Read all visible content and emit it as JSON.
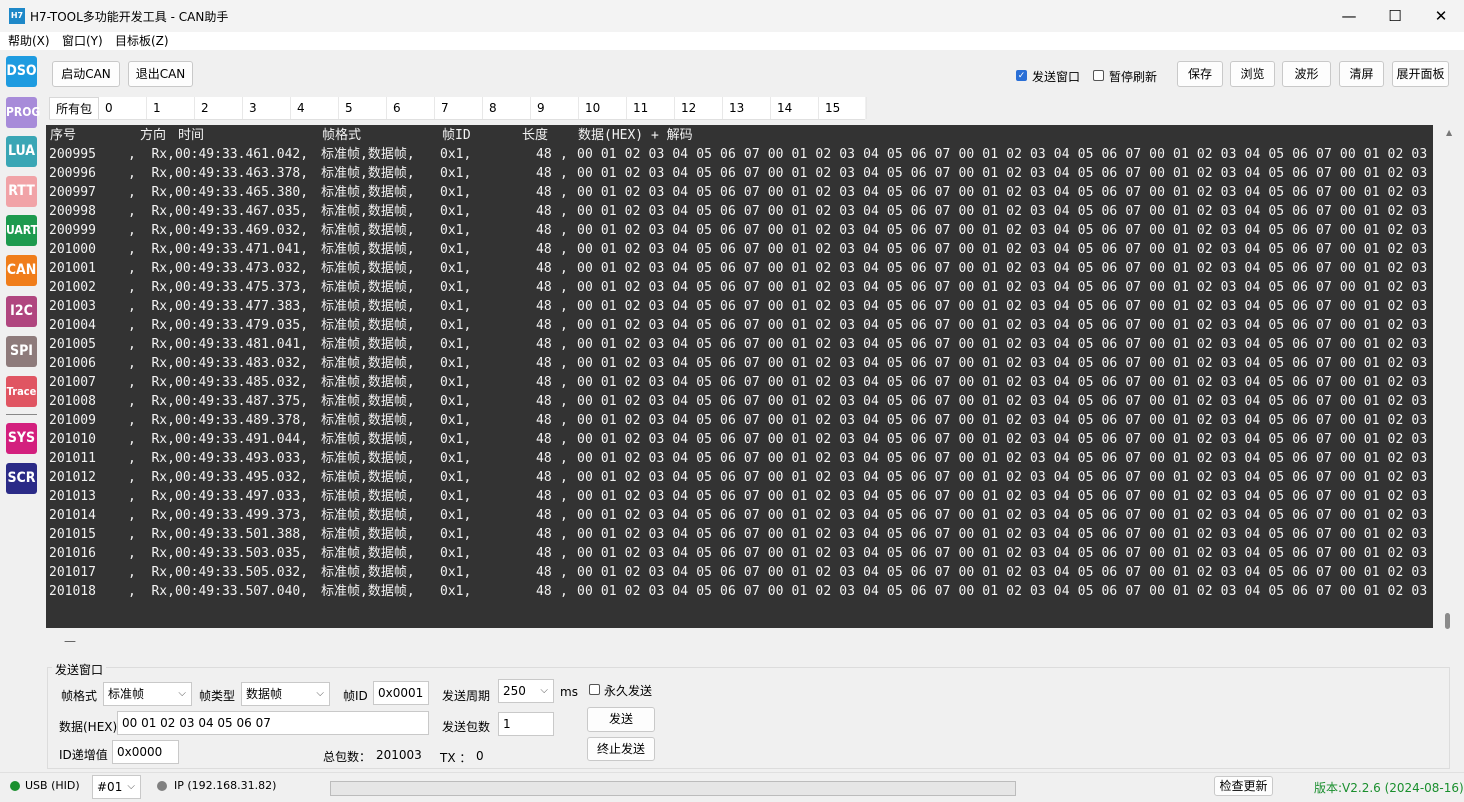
{
  "window": {
    "title": "H7-TOOL多功能开发工具 - CAN助手",
    "icon_text": "H7",
    "minimize": "—",
    "maximize": "☐",
    "close": "✕"
  },
  "menu": [
    "帮助(X)",
    "窗口(Y)",
    "目标板(Z)"
  ],
  "sidebar": [
    {
      "label": "DSO",
      "color": "#1e9be0"
    },
    {
      "label": "PROG",
      "color": "#a78bd9"
    },
    {
      "label": "LUA",
      "color": "#3aa6b5"
    },
    {
      "label": "RTT",
      "color": "#f1a3a7"
    },
    {
      "label": "UART",
      "color": "#1d9a4e"
    },
    {
      "label": "CAN",
      "color": "#f07d1a"
    },
    {
      "label": "I2C",
      "color": "#b0467f"
    },
    {
      "label": "SPI",
      "color": "#8e7b7b"
    },
    {
      "label": "Trace",
      "color": "#e05562"
    },
    {
      "label": "SYS",
      "color": "#d3207e"
    },
    {
      "label": "SCR",
      "color": "#2b2b87"
    }
  ],
  "toolbar": {
    "start_can": "启动CAN",
    "exit_can": "退出CAN",
    "send_window_label": "发送窗口",
    "send_window_checked": true,
    "pause_refresh_label": "暂停刷新",
    "pause_refresh_checked": false,
    "save": "保存",
    "browse": "浏览",
    "wave": "波形",
    "clear": "清屏",
    "expand_panel": "展开面板"
  },
  "tabs": [
    "所有包",
    "0",
    "1",
    "2",
    "3",
    "4",
    "5",
    "6",
    "7",
    "8",
    "9",
    "10",
    "11",
    "12",
    "13",
    "14",
    "15"
  ],
  "console": {
    "header": {
      "seq": "序号",
      "dir": "方向",
      "time": "时间",
      "format": "帧格式",
      "id": "帧ID",
      "len": "长度",
      "data": "数据(HEX) + 解码"
    },
    "rows": [
      {
        "seq": "200995",
        "dir": "Rx,",
        "time": "00:49:33.461.042,",
        "fmt": "标准帧,数据帧,",
        "id": "0x1,",
        "len": "48",
        "sep": ",",
        "hex": "00 01 02 03 04 05 06 07 00 01 02 03 04 05 06 07 00 01 02 03 04 05 06 07 00 01 02 03 04 05 06 07 00 01 02 03"
      },
      {
        "seq": "200996",
        "dir": "Rx,",
        "time": "00:49:33.463.378,",
        "fmt": "标准帧,数据帧,",
        "id": "0x1,",
        "len": "48",
        "sep": ",",
        "hex": "00 01 02 03 04 05 06 07 00 01 02 03 04 05 06 07 00 01 02 03 04 05 06 07 00 01 02 03 04 05 06 07 00 01 02 03"
      },
      {
        "seq": "200997",
        "dir": "Rx,",
        "time": "00:49:33.465.380,",
        "fmt": "标准帧,数据帧,",
        "id": "0x1,",
        "len": "48",
        "sep": ",",
        "hex": "00 01 02 03 04 05 06 07 00 01 02 03 04 05 06 07 00 01 02 03 04 05 06 07 00 01 02 03 04 05 06 07 00 01 02 03"
      },
      {
        "seq": "200998",
        "dir": "Rx,",
        "time": "00:49:33.467.035,",
        "fmt": "标准帧,数据帧,",
        "id": "0x1,",
        "len": "48",
        "sep": ",",
        "hex": "00 01 02 03 04 05 06 07 00 01 02 03 04 05 06 07 00 01 02 03 04 05 06 07 00 01 02 03 04 05 06 07 00 01 02 03"
      },
      {
        "seq": "200999",
        "dir": "Rx,",
        "time": "00:49:33.469.032,",
        "fmt": "标准帧,数据帧,",
        "id": "0x1,",
        "len": "48",
        "sep": ",",
        "hex": "00 01 02 03 04 05 06 07 00 01 02 03 04 05 06 07 00 01 02 03 04 05 06 07 00 01 02 03 04 05 06 07 00 01 02 03"
      },
      {
        "seq": "201000",
        "dir": "Rx,",
        "time": "00:49:33.471.041,",
        "fmt": "标准帧,数据帧,",
        "id": "0x1,",
        "len": "48",
        "sep": ",",
        "hex": "00 01 02 03 04 05 06 07 00 01 02 03 04 05 06 07 00 01 02 03 04 05 06 07 00 01 02 03 04 05 06 07 00 01 02 03"
      },
      {
        "seq": "201001",
        "dir": "Rx,",
        "time": "00:49:33.473.032,",
        "fmt": "标准帧,数据帧,",
        "id": "0x1,",
        "len": "48",
        "sep": ",",
        "hex": "00 01 02 03 04 05 06 07 00 01 02 03 04 05 06 07 00 01 02 03 04 05 06 07 00 01 02 03 04 05 06 07 00 01 02 03"
      },
      {
        "seq": "201002",
        "dir": "Rx,",
        "time": "00:49:33.475.373,",
        "fmt": "标准帧,数据帧,",
        "id": "0x1,",
        "len": "48",
        "sep": ",",
        "hex": "00 01 02 03 04 05 06 07 00 01 02 03 04 05 06 07 00 01 02 03 04 05 06 07 00 01 02 03 04 05 06 07 00 01 02 03"
      },
      {
        "seq": "201003",
        "dir": "Rx,",
        "time": "00:49:33.477.383,",
        "fmt": "标准帧,数据帧,",
        "id": "0x1,",
        "len": "48",
        "sep": ",",
        "hex": "00 01 02 03 04 05 06 07 00 01 02 03 04 05 06 07 00 01 02 03 04 05 06 07 00 01 02 03 04 05 06 07 00 01 02 03"
      },
      {
        "seq": "201004",
        "dir": "Rx,",
        "time": "00:49:33.479.035,",
        "fmt": "标准帧,数据帧,",
        "id": "0x1,",
        "len": "48",
        "sep": ",",
        "hex": "00 01 02 03 04 05 06 07 00 01 02 03 04 05 06 07 00 01 02 03 04 05 06 07 00 01 02 03 04 05 06 07 00 01 02 03"
      },
      {
        "seq": "201005",
        "dir": "Rx,",
        "time": "00:49:33.481.041,",
        "fmt": "标准帧,数据帧,",
        "id": "0x1,",
        "len": "48",
        "sep": ",",
        "hex": "00 01 02 03 04 05 06 07 00 01 02 03 04 05 06 07 00 01 02 03 04 05 06 07 00 01 02 03 04 05 06 07 00 01 02 03"
      },
      {
        "seq": "201006",
        "dir": "Rx,",
        "time": "00:49:33.483.032,",
        "fmt": "标准帧,数据帧,",
        "id": "0x1,",
        "len": "48",
        "sep": ",",
        "hex": "00 01 02 03 04 05 06 07 00 01 02 03 04 05 06 07 00 01 02 03 04 05 06 07 00 01 02 03 04 05 06 07 00 01 02 03"
      },
      {
        "seq": "201007",
        "dir": "Rx,",
        "time": "00:49:33.485.032,",
        "fmt": "标准帧,数据帧,",
        "id": "0x1,",
        "len": "48",
        "sep": ",",
        "hex": "00 01 02 03 04 05 06 07 00 01 02 03 04 05 06 07 00 01 02 03 04 05 06 07 00 01 02 03 04 05 06 07 00 01 02 03"
      },
      {
        "seq": "201008",
        "dir": "Rx,",
        "time": "00:49:33.487.375,",
        "fmt": "标准帧,数据帧,",
        "id": "0x1,",
        "len": "48",
        "sep": ",",
        "hex": "00 01 02 03 04 05 06 07 00 01 02 03 04 05 06 07 00 01 02 03 04 05 06 07 00 01 02 03 04 05 06 07 00 01 02 03"
      },
      {
        "seq": "201009",
        "dir": "Rx,",
        "time": "00:49:33.489.378,",
        "fmt": "标准帧,数据帧,",
        "id": "0x1,",
        "len": "48",
        "sep": ",",
        "hex": "00 01 02 03 04 05 06 07 00 01 02 03 04 05 06 07 00 01 02 03 04 05 06 07 00 01 02 03 04 05 06 07 00 01 02 03"
      },
      {
        "seq": "201010",
        "dir": "Rx,",
        "time": "00:49:33.491.044,",
        "fmt": "标准帧,数据帧,",
        "id": "0x1,",
        "len": "48",
        "sep": ",",
        "hex": "00 01 02 03 04 05 06 07 00 01 02 03 04 05 06 07 00 01 02 03 04 05 06 07 00 01 02 03 04 05 06 07 00 01 02 03"
      },
      {
        "seq": "201011",
        "dir": "Rx,",
        "time": "00:49:33.493.033,",
        "fmt": "标准帧,数据帧,",
        "id": "0x1,",
        "len": "48",
        "sep": ",",
        "hex": "00 01 02 03 04 05 06 07 00 01 02 03 04 05 06 07 00 01 02 03 04 05 06 07 00 01 02 03 04 05 06 07 00 01 02 03"
      },
      {
        "seq": "201012",
        "dir": "Rx,",
        "time": "00:49:33.495.032,",
        "fmt": "标准帧,数据帧,",
        "id": "0x1,",
        "len": "48",
        "sep": ",",
        "hex": "00 01 02 03 04 05 06 07 00 01 02 03 04 05 06 07 00 01 02 03 04 05 06 07 00 01 02 03 04 05 06 07 00 01 02 03"
      },
      {
        "seq": "201013",
        "dir": "Rx,",
        "time": "00:49:33.497.033,",
        "fmt": "标准帧,数据帧,",
        "id": "0x1,",
        "len": "48",
        "sep": ",",
        "hex": "00 01 02 03 04 05 06 07 00 01 02 03 04 05 06 07 00 01 02 03 04 05 06 07 00 01 02 03 04 05 06 07 00 01 02 03"
      },
      {
        "seq": "201014",
        "dir": "Rx,",
        "time": "00:49:33.499.373,",
        "fmt": "标准帧,数据帧,",
        "id": "0x1,",
        "len": "48",
        "sep": ",",
        "hex": "00 01 02 03 04 05 06 07 00 01 02 03 04 05 06 07 00 01 02 03 04 05 06 07 00 01 02 03 04 05 06 07 00 01 02 03"
      },
      {
        "seq": "201015",
        "dir": "Rx,",
        "time": "00:49:33.501.388,",
        "fmt": "标准帧,数据帧,",
        "id": "0x1,",
        "len": "48",
        "sep": ",",
        "hex": "00 01 02 03 04 05 06 07 00 01 02 03 04 05 06 07 00 01 02 03 04 05 06 07 00 01 02 03 04 05 06 07 00 01 02 03"
      },
      {
        "seq": "201016",
        "dir": "Rx,",
        "time": "00:49:33.503.035,",
        "fmt": "标准帧,数据帧,",
        "id": "0x1,",
        "len": "48",
        "sep": ",",
        "hex": "00 01 02 03 04 05 06 07 00 01 02 03 04 05 06 07 00 01 02 03 04 05 06 07 00 01 02 03 04 05 06 07 00 01 02 03"
      },
      {
        "seq": "201017",
        "dir": "Rx,",
        "time": "00:49:33.505.032,",
        "fmt": "标准帧,数据帧,",
        "id": "0x1,",
        "len": "48",
        "sep": ",",
        "hex": "00 01 02 03 04 05 06 07 00 01 02 03 04 05 06 07 00 01 02 03 04 05 06 07 00 01 02 03 04 05 06 07 00 01 02 03"
      },
      {
        "seq": "201018",
        "dir": "Rx,",
        "time": "00:49:33.507.040,",
        "fmt": "标准帧,数据帧,",
        "id": "0x1,",
        "len": "48",
        "sep": ",",
        "hex": "00 01 02 03 04 05 06 07 00 01 02 03 04 05 06 07 00 01 02 03 04 05 06 07 00 01 02 03 04 05 06 07 00 01 02 03"
      }
    ],
    "hscroll_mark": "—"
  },
  "send_panel": {
    "legend": "发送窗口",
    "frame_format_label": "帧格式",
    "frame_format_value": "标准帧",
    "frame_type_label": "帧类型",
    "frame_type_value": "数据帧",
    "frame_id_label": "帧ID",
    "frame_id_value": "0x0001",
    "period_label": "发送周期",
    "period_value": "250",
    "period_unit": "ms",
    "forever_label": "永久发送",
    "data_label": "数据(HEX)",
    "data_value": "00 01 02 03 04 05 06 07",
    "count_label": "发送包数",
    "count_value": "1",
    "send_button": "发送",
    "stop_button": "终止发送",
    "id_inc_label": "ID递增值",
    "id_inc_value": "0x0000",
    "total_label": "总包数：",
    "total_value": "201003",
    "tx_label": "TX ：",
    "tx_value": "0"
  },
  "status": {
    "usb": "USB (HID)",
    "usb_color": "#1a8f2e",
    "port": "#01",
    "ip": "IP (192.168.31.82)",
    "ip_color": "#808080",
    "check_update": "检查更新",
    "version": "版本:V2.2.6 (2024-08-16)",
    "version_color": "#1a8f2e"
  }
}
